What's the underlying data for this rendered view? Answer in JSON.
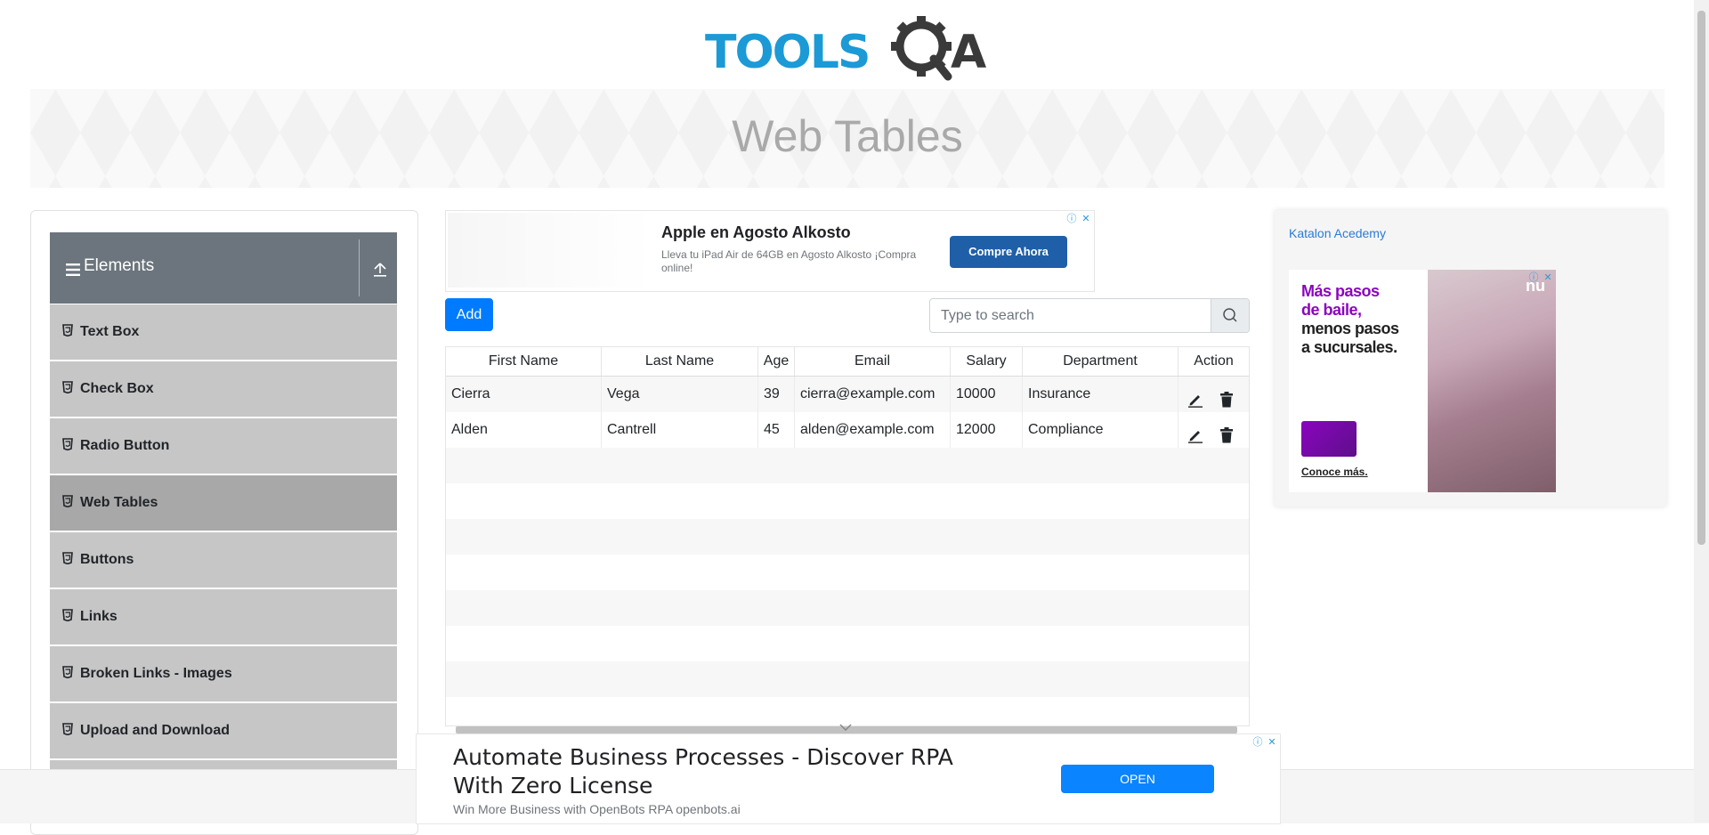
{
  "brand": {
    "logo_text_left": "TOOLS",
    "logo_text_right": "A"
  },
  "page": {
    "title": "Web Tables"
  },
  "sidebar": {
    "group_title": "Elements",
    "items": [
      {
        "label": "Text Box"
      },
      {
        "label": "Check Box"
      },
      {
        "label": "Radio Button"
      },
      {
        "label": "Web Tables",
        "active": true
      },
      {
        "label": "Buttons"
      },
      {
        "label": "Links"
      },
      {
        "label": "Broken Links - Images"
      },
      {
        "label": "Upload and Download"
      }
    ]
  },
  "ad_top": {
    "headline": "Apple en Agosto Alkosto",
    "description": "Lleva tu iPad Air de 64GB en Agosto Alkosto ¡Compra online!",
    "cta": "Compre Ahora"
  },
  "toolbar": {
    "add_label": "Add",
    "search_placeholder": "Type to search"
  },
  "table": {
    "columns": [
      "First Name",
      "Last Name",
      "Age",
      "Email",
      "Salary",
      "Department",
      "Action"
    ],
    "rows": [
      {
        "first": "Cierra",
        "last": "Vega",
        "age": "39",
        "email": "cierra@example.com",
        "salary": "10000",
        "department": "Insurance"
      },
      {
        "first": "Alden",
        "last": "Cantrell",
        "age": "45",
        "email": "alden@example.com",
        "salary": "12000",
        "department": "Compliance"
      }
    ],
    "empty_rows": 6
  },
  "ad_right": {
    "image_alt": "Katalon Acedemy",
    "line1": "Más pasos",
    "line2": "de baile,",
    "line3": "menos pasos",
    "line4": "a sucursales.",
    "link": "Conoce más.",
    "brand_mark": "nu"
  },
  "ad_bottom": {
    "headline": "Automate Business Processes - Discover RPA With Zero License",
    "description": "Win More Business with OpenBots RPA openbots.ai",
    "cta": "OPEN"
  },
  "colors": {
    "primary": "#007bff",
    "sidebar_header": "#6c757d",
    "sidebar_item": "#c6c6c6",
    "logo_blue": "#1b9ad6",
    "logo_dark": "#3a3a3a"
  }
}
